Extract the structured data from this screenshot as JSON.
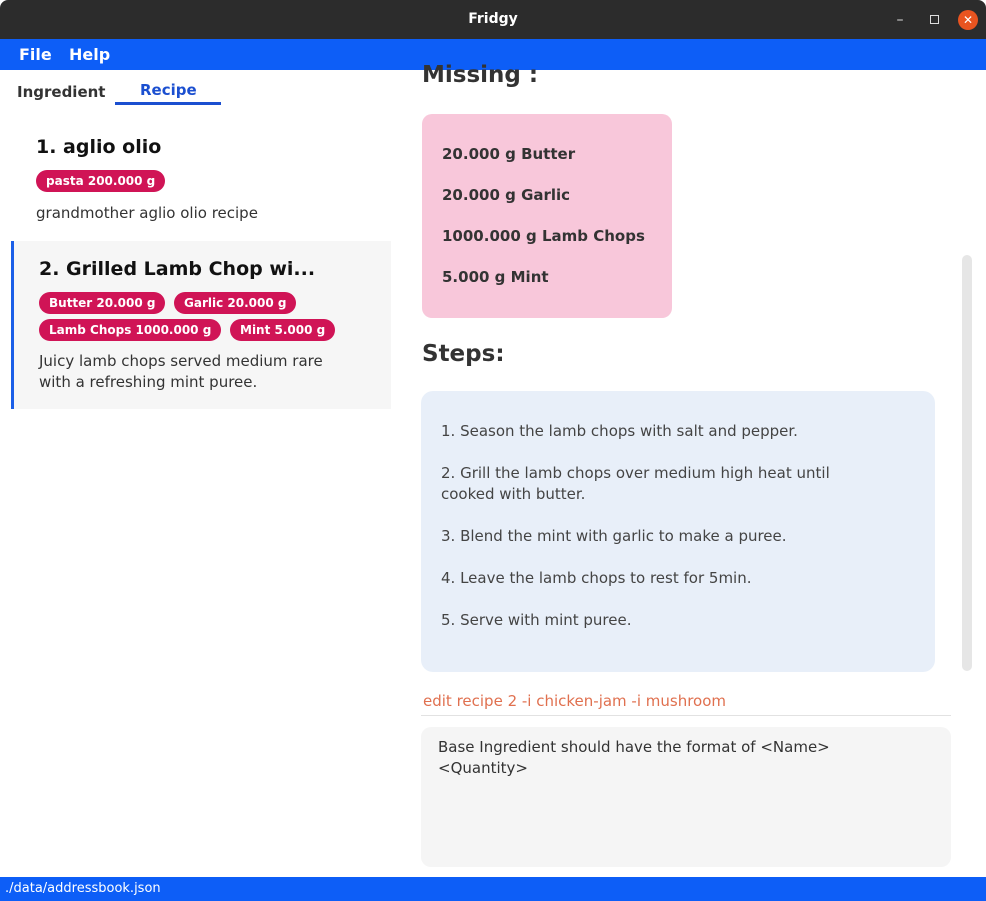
{
  "window": {
    "title": "Fridgy",
    "minimize_glyph": "–",
    "close_glyph": "✕"
  },
  "menu": {
    "file": "File",
    "help": "Help"
  },
  "tabs": [
    {
      "label": "Ingredient",
      "active": false
    },
    {
      "label": "Recipe",
      "active": true
    }
  ],
  "recipes": [
    {
      "title": "1.  aglio olio",
      "tags": [
        "pasta 200.000 g"
      ],
      "description": "grandmother aglio olio recipe"
    },
    {
      "title": "2.  Grilled Lamb Chop wi...",
      "tags": [
        "Butter 20.000 g",
        "Garlic 20.000 g",
        "Lamb Chops 1000.000 g",
        "Mint 5.000 g"
      ],
      "description": "Juicy lamb chops served medium rare with a refreshing mint puree."
    }
  ],
  "detail": {
    "missing_heading": "Missing :",
    "missing_items": [
      "20.000 g Butter",
      "20.000 g Garlic",
      "1000.000 g Lamb Chops",
      "5.000 g Mint"
    ],
    "steps_heading": "Steps:",
    "steps": [
      "1. Season the lamb chops with salt and pepper.",
      "2. Grill the lamb chops over medium high heat until cooked with butter.",
      "3. Blend the mint with garlic to make a puree.",
      "4. Leave the lamb chops to rest for 5min.",
      "5. Serve with mint puree."
    ]
  },
  "command": {
    "value": "edit recipe 2 -i chicken-jam -i mushroom"
  },
  "result": {
    "text": "Base Ingredient should have the format of <Name> <Quantity>"
  },
  "status": {
    "path": "./data/addressbook.json"
  },
  "colors": {
    "accent_blue": "#0d5ef7",
    "tag_pink": "#d01456",
    "missing_bg": "#f8c7da",
    "steps_bg": "#e8eff9",
    "command_text": "#e0704f"
  }
}
